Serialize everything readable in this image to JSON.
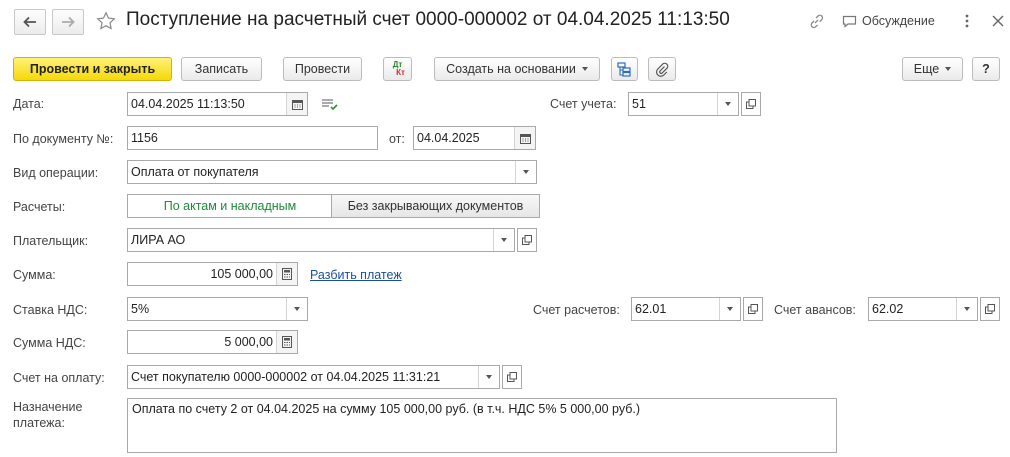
{
  "window": {
    "title": "Поступление на расчетный счет 0000-000002 от 04.04.2025 11:13:50",
    "discussion_label": "Обсуждение"
  },
  "toolbar": {
    "post_close_label": "Провести и закрыть",
    "save_label": "Записать",
    "post_label": "Провести",
    "dtkt_top": "Дт",
    "dtkt_bottom": "Кт",
    "create_based_label": "Создать на основании",
    "more_label": "Еще",
    "help_label": "?"
  },
  "form": {
    "date_label": "Дата:",
    "date_value": "04.04.2025 11:13:50",
    "account_label": "Счет учета:",
    "account_value": "51",
    "doc_no_label": "По документу №:",
    "doc_no_value": "1156",
    "from_label": "от:",
    "from_value": "04.04.2025",
    "op_label": "Вид операции:",
    "op_value": "Оплата от покупателя",
    "settle_label": "Расчеты:",
    "settle_opt1": "По актам и накладным",
    "settle_opt2": "Без закрывающих документов",
    "payer_label": "Плательщик:",
    "payer_value": "ЛИРА АО",
    "sum_label": "Сумма:",
    "sum_value": "105 000,00",
    "split_link": "Разбить платеж",
    "vat_rate_label": "Ставка НДС:",
    "vat_rate_value": "5%",
    "settle_acc_label": "Счет расчетов:",
    "settle_acc_value": "62.01",
    "advance_acc_label": "Счет авансов:",
    "advance_acc_value": "62.02",
    "vat_sum_label": "Сумма НДС:",
    "vat_sum_value": "5 000,00",
    "invoice_label": "Счет на оплату:",
    "invoice_value": "Счет покупателю 0000-000002 от 04.04.2025 11:31:21",
    "purpose_label_1": "Назначение",
    "purpose_label_2": "платежа:",
    "purpose_value": "Оплата по счету 2 от 04.04.2025 на сумму 105 000,00 руб. (в т.ч. НДС 5% 5 000,00 руб.)"
  }
}
